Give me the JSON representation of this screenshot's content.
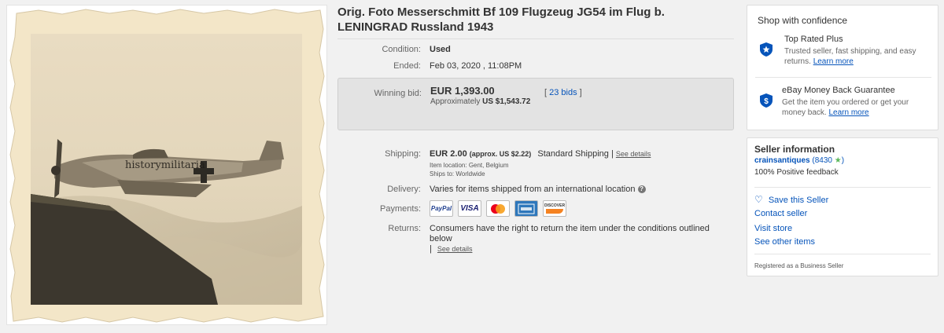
{
  "listing": {
    "title": "Orig. Foto Messerschmitt Bf 109 Flugzeug JG54 im Flug b. LENINGRAD Russland 1943",
    "photo": {
      "watermark": "historymilitaria"
    }
  },
  "details": {
    "condition_label": "Condition:",
    "condition_value": "Used",
    "ended_label": "Ended:",
    "ended_value": "Feb 03, 2020 , 11:08PM"
  },
  "bid": {
    "label": "Winning bid:",
    "amount": "EUR 1,393.00",
    "approx_prefix": "Approximately",
    "approx_value": "US $1,543.72",
    "bids_open": "[ ",
    "bids_link": "23 bids",
    "bids_close": " ]"
  },
  "shipping": {
    "label": "Shipping:",
    "cost": "EUR 2.00",
    "approx": "(approx. US $2.22)",
    "method": "Standard Shipping",
    "separator": "|",
    "see_details": "See details",
    "location_label": "Item location:",
    "location": "Gent, Belgium",
    "ships_to_label": "Ships to:",
    "ships_to": "Worldwide"
  },
  "delivery": {
    "label": "Delivery:",
    "value": "Varies for items shipped from an international location",
    "help_icon": "?"
  },
  "payments": {
    "label": "Payments:",
    "methods": [
      "PayPal",
      "VISA",
      "Mastercard",
      "American Express",
      "DISCOVER"
    ]
  },
  "returns": {
    "label": "Returns:",
    "text": "Consumers have the right to return the item under the conditions outlined below",
    "separator": "|",
    "see_details": "See details"
  },
  "shop_confidence": {
    "title": "Shop with confidence",
    "top_rated_title": "Top Rated Plus",
    "top_rated_text": "Trusted seller, fast shipping, and easy returns.",
    "top_rated_link": "Learn more",
    "guarantee_title": "eBay Money Back Guarantee",
    "guarantee_text": "Get the item you ordered or get your money back.",
    "guarantee_link": "Learn more"
  },
  "seller": {
    "title": "Seller information",
    "name": "crainsantiques",
    "feedback_open": "(",
    "feedback_score": "8430",
    "feedback_close": ")",
    "positive": "100% Positive feedback",
    "save": "Save this Seller",
    "contact": "Contact seller",
    "visit": "Visit store",
    "other": "See other items",
    "registered": "Registered as a Business Seller"
  },
  "colors": {
    "link": "#0654ba",
    "bid_box": "#e3e3e3",
    "star": "#5cb85c",
    "shield": "#0654ba"
  }
}
